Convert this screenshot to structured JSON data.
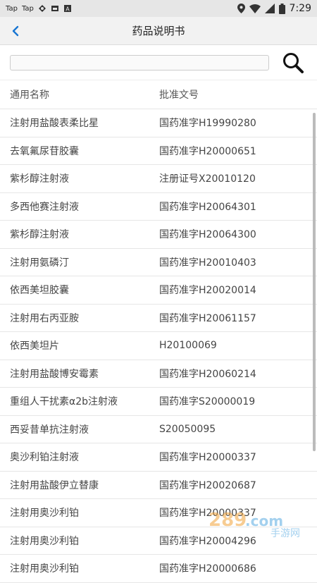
{
  "statusbar": {
    "left_items": [
      "Tap",
      "Tap"
    ],
    "time": "7:29"
  },
  "appbar": {
    "title": "药品说明书"
  },
  "search": {
    "value": "",
    "placeholder": ""
  },
  "table": {
    "headers": {
      "name": "通用名称",
      "approval": "批准文号"
    },
    "rows": [
      {
        "name": "注射用盐酸表柔比星",
        "approval": "国药准字H19990280"
      },
      {
        "name": "去氧氟尿苷胶囊",
        "approval": "国药准字H20000651"
      },
      {
        "name": "紫杉醇注射液",
        "approval": "注册证号X20010120"
      },
      {
        "name": "多西他赛注射液",
        "approval": "国药准字H20064301"
      },
      {
        "name": "紫杉醇注射液",
        "approval": "国药准字H20064300"
      },
      {
        "name": "注射用氨磷汀",
        "approval": "国药准字H20010403"
      },
      {
        "name": "依西美坦胶囊",
        "approval": "国药准字H20020014"
      },
      {
        "name": "注射用右丙亚胺",
        "approval": "国药准字H20061157"
      },
      {
        "name": "依西美坦片",
        "approval": "H20100069"
      },
      {
        "name": "注射用盐酸博安霉素",
        "approval": "国药准字H20060214"
      },
      {
        "name": "重组人干扰素α2b注射液",
        "approval": "国药准字S20000019"
      },
      {
        "name": "西妥昔单抗注射液",
        "approval": "S20050095"
      },
      {
        "name": "奥沙利铂注射液",
        "approval": "国药准字H20000337"
      },
      {
        "name": "注射用盐酸伊立替康",
        "approval": "国药准字H20020687"
      },
      {
        "name": "注射用奥沙利铂",
        "approval": "国药准字H20000337"
      },
      {
        "name": "注射用奥沙利铂",
        "approval": "国药准字H20004296"
      },
      {
        "name": "注射用奥沙利铂",
        "approval": "国药准字H20000686"
      }
    ]
  },
  "watermark": {
    "text": "289.com 手游网"
  },
  "colors": {
    "accent": "#1976d2",
    "divider": "#e6e6e6"
  }
}
